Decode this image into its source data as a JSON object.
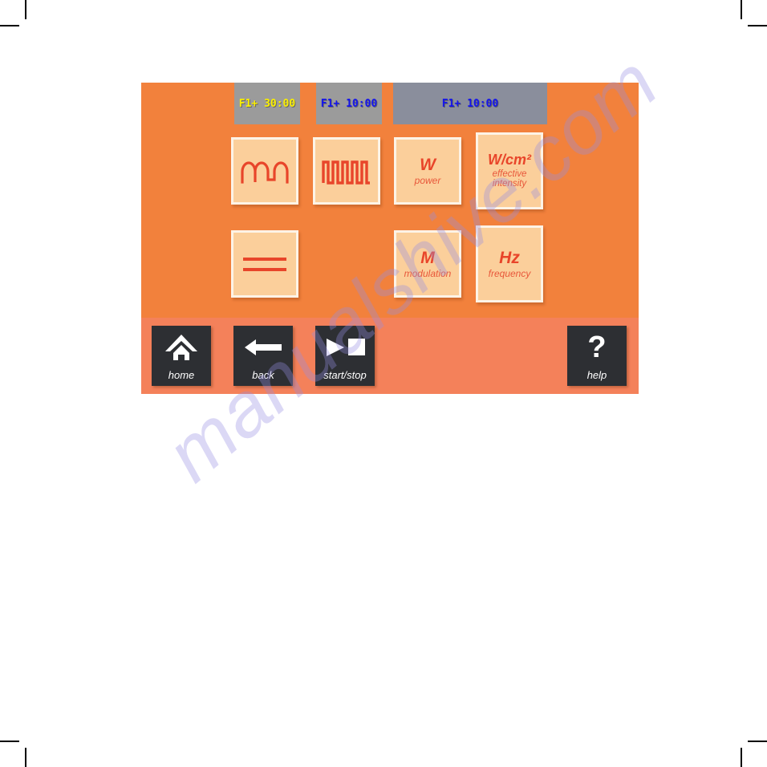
{
  "watermark": {
    "text": "manualshive.com"
  },
  "device": {
    "panel_color": "#f2813c",
    "nav_bar_color": "#f4815a",
    "accent_color": "#e8452a",
    "button_face_color": "#fbcf9b"
  },
  "tabs": [
    {
      "label": "F1+ 30:00",
      "text_color": "#fbf000",
      "bg_color": "#9b9b9b",
      "name": "program-tab-1"
    },
    {
      "label": "F1+ 10:00",
      "text_color": "#1414ee",
      "bg_color": "#9b9b9b",
      "name": "program-tab-2"
    },
    {
      "label": "F1+ 10:00",
      "text_color": "#1414ee",
      "bg_color": "#8a8e9c",
      "name": "program-tab-3"
    }
  ],
  "function_buttons": [
    {
      "icon": "pulsed-wave-icon",
      "main": "",
      "sub": ""
    },
    {
      "icon": "square-wave-icon",
      "main": "",
      "sub": ""
    },
    {
      "icon": "power-icon",
      "main": "W",
      "sub": "power"
    },
    {
      "icon": "effective-intensity-icon",
      "main": "W/cm²",
      "sub": "effective\nintensity",
      "sub_line1": "effective",
      "sub_line2": "intensity"
    },
    {
      "icon": "continuous-wave-icon",
      "main": "",
      "sub": ""
    },
    {
      "icon": "modulation-icon",
      "main": "M",
      "sub": "modulation"
    },
    {
      "icon": "frequency-icon",
      "main": "Hz",
      "sub": "frequency"
    }
  ],
  "nav": {
    "home_label": "home",
    "back_label": "back",
    "start_stop_label": "start/stop",
    "help_label": "help",
    "help_glyph": "?"
  }
}
